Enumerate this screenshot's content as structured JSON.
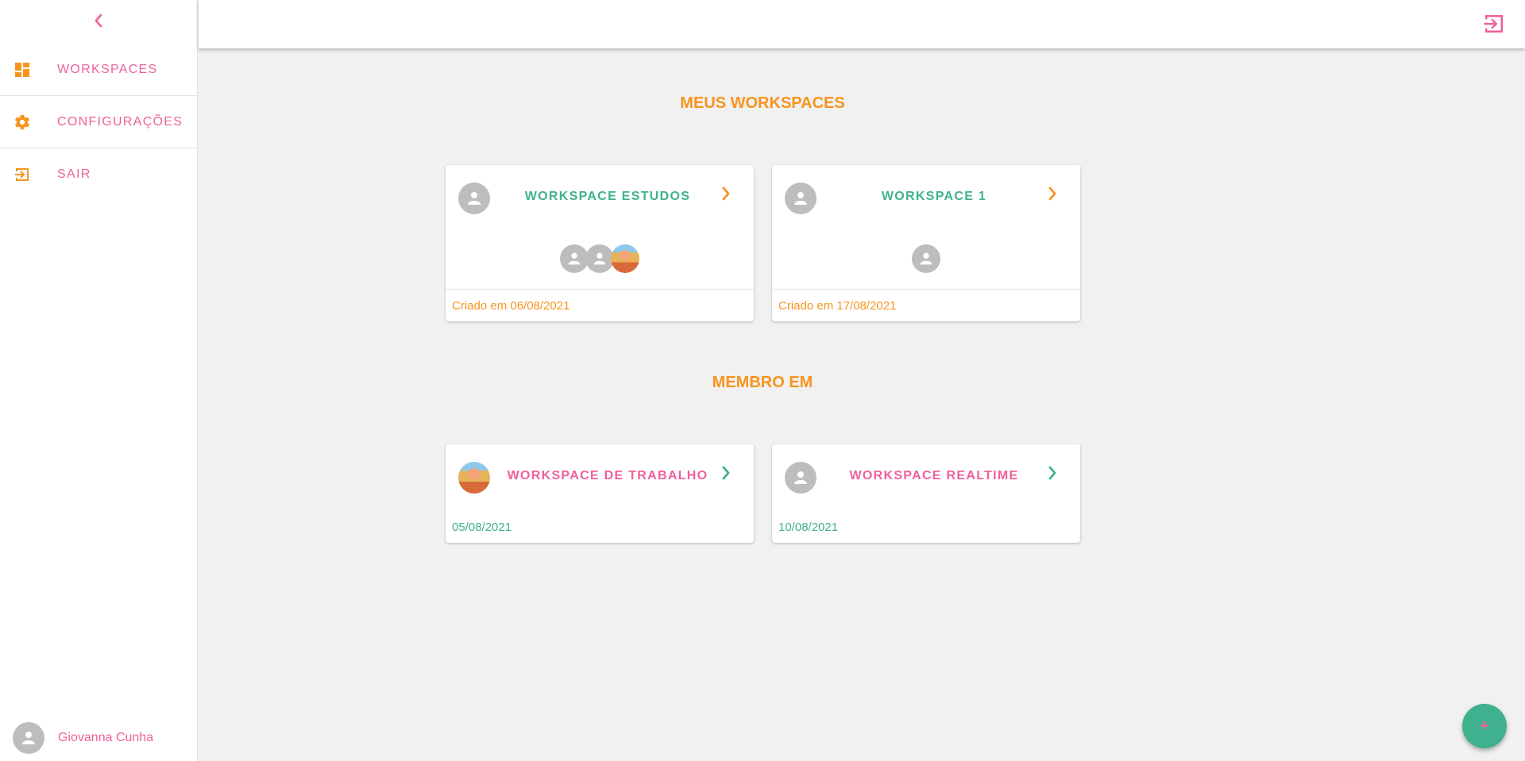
{
  "colors": {
    "pink": "#f0609a",
    "orange": "#f7941d",
    "green": "#3fb18f",
    "avatar_grey": "#bdbdbd"
  },
  "sidebar": {
    "collapse_icon": "chevron-left-icon",
    "items": [
      {
        "label": "WORKSPACES",
        "icon": "dashboard-icon"
      },
      {
        "label": "CONFIGURAÇÕES",
        "icon": "gear-icon"
      },
      {
        "label": "SAIR",
        "icon": "exit-icon"
      }
    ],
    "user_name": "Giovanna Cunha"
  },
  "topbar": {
    "logout_icon": "exit-icon"
  },
  "sections": {
    "my_workspaces_title": "MEUS WORKSPACES",
    "member_of_title": "MEMBRO EM"
  },
  "my_workspaces": [
    {
      "title": "WORKSPACE ESTUDOS",
      "footer": "Criado em 06/08/2021"
    },
    {
      "title": "WORKSPACE 1",
      "footer": "Criado em 17/08/2021"
    }
  ],
  "member_workspaces": [
    {
      "title": "WORKSPACE DE TRABALHO",
      "date": "05/08/2021"
    },
    {
      "title": "WORKSPACE REALTIME",
      "date": "10/08/2021"
    }
  ],
  "fab": {
    "label": "+"
  }
}
